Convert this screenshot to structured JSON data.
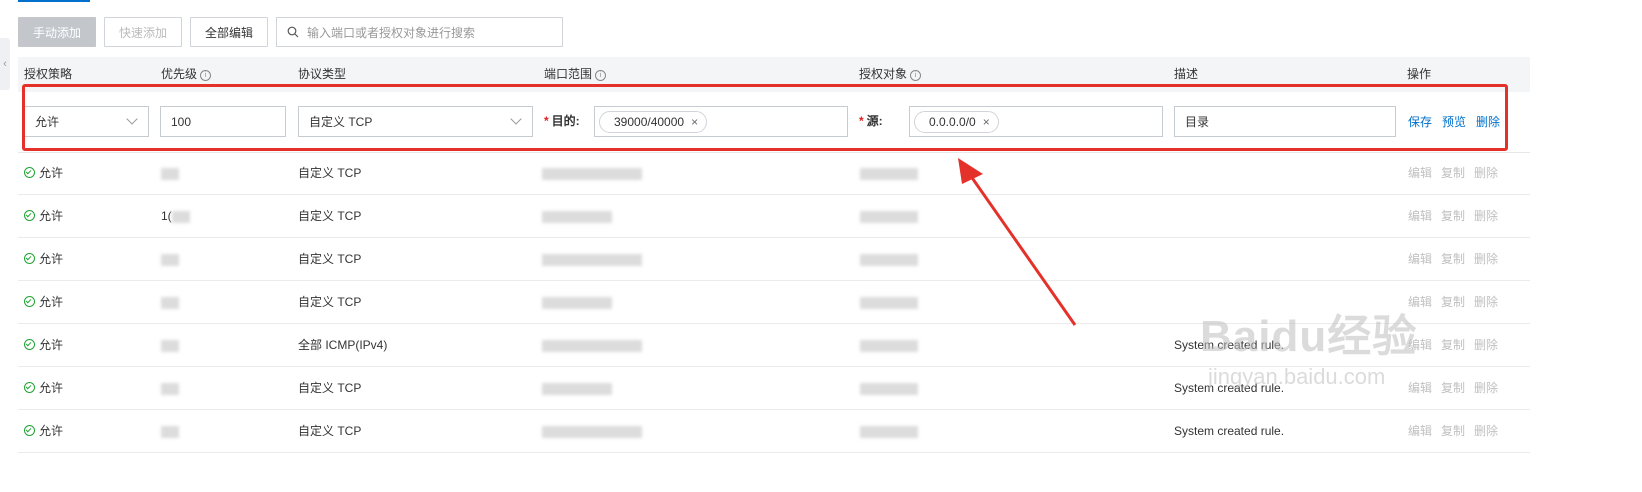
{
  "toolbar": {
    "manual_add": "手动添加",
    "quick_add": "快速添加",
    "edit_all": "全部编辑",
    "search_placeholder": "输入端口或者授权对象进行搜索"
  },
  "columns": {
    "policy": "授权策略",
    "priority": "优先级",
    "protocol": "协议类型",
    "port_range": "端口范围",
    "auth_object": "授权对象",
    "description": "描述",
    "actions": "操作"
  },
  "edit_row": {
    "policy": "允许",
    "priority": "100",
    "protocol": "自定义 TCP",
    "dest_label": "目的:",
    "dest_tag": "39000/40000",
    "source_label": "源:",
    "source_tag": "0.0.0.0/0",
    "description": "目录",
    "save": "保存",
    "preview": "预览",
    "delete": "删除"
  },
  "rows": [
    {
      "policy": "允许",
      "priority": "",
      "protocol": "自定义 TCP",
      "description": ""
    },
    {
      "policy": "允许",
      "priority": "1(",
      "protocol": "自定义 TCP",
      "description": ""
    },
    {
      "policy": "允许",
      "priority": "",
      "protocol": "自定义 TCP",
      "description": ""
    },
    {
      "policy": "允许",
      "priority": "",
      "protocol": "自定义 TCP",
      "description": ""
    },
    {
      "policy": "允许",
      "priority": "",
      "protocol": "全部 ICMP(IPv4)",
      "description": "System created rule."
    },
    {
      "policy": "允许",
      "priority": "",
      "protocol": "自定义 TCP",
      "description": "System created rule."
    },
    {
      "policy": "允许",
      "priority": "",
      "protocol": "自定义 TCP",
      "description": "System created rule."
    }
  ],
  "row_actions": {
    "edit": "编辑",
    "copy": "复制",
    "delete": "删除"
  },
  "watermark": {
    "brand": "Baidu经验",
    "url": "jingyan.baidu.com"
  },
  "colors": {
    "link": "#0070cc",
    "highlight": "#e4322b",
    "ok": "#21a336"
  }
}
